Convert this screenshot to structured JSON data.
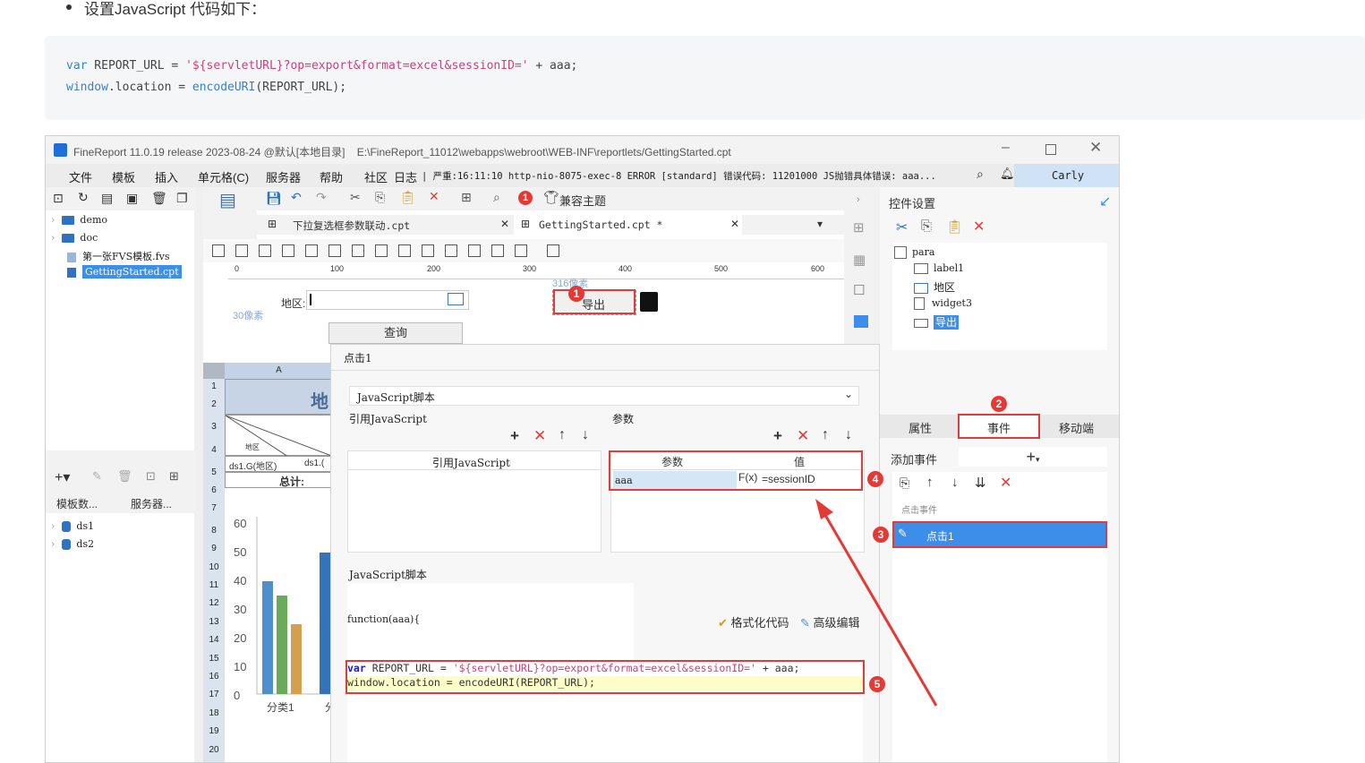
{
  "intro_text": "设置JavaScript 代码如下：",
  "code": {
    "line1_kw": "var",
    "line1_rest": " REPORT_URL = ",
    "line1_str": "'${servletURL}?op=export&format=excel&sessionID='",
    "line1_end": " + aaa;",
    "line2_kw1": "window",
    "line2_mid": ".location = ",
    "line2_kw2": "encodeURI",
    "line2_end": "(REPORT_URL);"
  },
  "window": {
    "title": "FineReport 11.0.19 release 2023-08-24 @默认[本地目录]    E:\\FineReport_11012\\webapps\\webroot\\WEB-INF\\reportlets/GettingStarted.cpt",
    "menu": [
      "文件",
      "模板",
      "插入",
      "单元格(C)",
      "服务器",
      "帮助",
      "社区",
      "日志"
    ],
    "log_line": "| 严重:16:11:10 http-nio-8075-exec-8 ERROR [standard] 错误代码: 11201000 JS抛错具体错误: aaa...",
    "user": "Carly"
  },
  "file_tree": [
    "demo",
    "doc",
    "第一张FVS模板.fvs",
    "GettingStarted.cpt"
  ],
  "datasource_tabs": [
    "模板数...",
    "服务器..."
  ],
  "datasets": [
    "ds1",
    "ds2"
  ],
  "editor_tabs": [
    "下拉复选框参数联动.cpt",
    "GettingStarted.cpt *"
  ],
  "compat_theme": "兼容主题",
  "error_count": "1",
  "ruler_marks": [
    "0",
    "100",
    "200",
    "300",
    "400",
    "500",
    "600"
  ],
  "param_pane": {
    "region_label": "地区:",
    "query_button": "查询",
    "export_button": "导出",
    "px_316": "316像素",
    "px_30": "30像素"
  },
  "sheet": {
    "col_a": "A",
    "rows": [
      "1",
      "2",
      "3",
      "4",
      "5",
      "6",
      "7",
      "8",
      "9",
      "10",
      "11",
      "12",
      "13",
      "14",
      "15",
      "16",
      "17",
      "18",
      "19",
      "20"
    ],
    "title_cell": "地",
    "cell_region": "地区",
    "cell_ds": "ds1.G(地区)",
    "cell_ds2": "ds1.(",
    "cell_total": "总计:",
    "y_ticks": [
      "60",
      "50",
      "40",
      "30",
      "20",
      "10",
      "0"
    ],
    "x_cat": "分类1",
    "x_cat2": "分"
  },
  "dialog": {
    "title": "点击1",
    "type": "JavaScript脚本",
    "ref_js_label": "引用JavaScript",
    "params_label": "参数",
    "ref_js_header": "引用JavaScript",
    "param_col": "参数",
    "value_col": "值",
    "param_name": "aaa",
    "param_value": "=sessionID",
    "fx": "F(x)",
    "script_label": "JavaScript脚本",
    "function_sig": "function(aaa){",
    "format_code": "格式化代码",
    "advanced_edit": "高级编辑",
    "script_line1_kw": "var",
    "script_line1_rest": " REPORT_URL = ",
    "script_line1_str": "'${servletURL}?op=export&format=excel&sessionID='",
    "script_line1_end": " + aaa;",
    "script_line2": "window.location = encodeURI(REPORT_URL);"
  },
  "widget_settings": {
    "title": "控件设置",
    "tree": [
      "para",
      "label1",
      "地区",
      "widget3",
      "导出"
    ],
    "tabs": [
      "属性",
      "事件",
      "移动端"
    ],
    "add_event": "添加事件",
    "event_group": "点击事件",
    "event_item": "点击1"
  },
  "badges": [
    "1",
    "2",
    "3",
    "4",
    "5"
  ]
}
